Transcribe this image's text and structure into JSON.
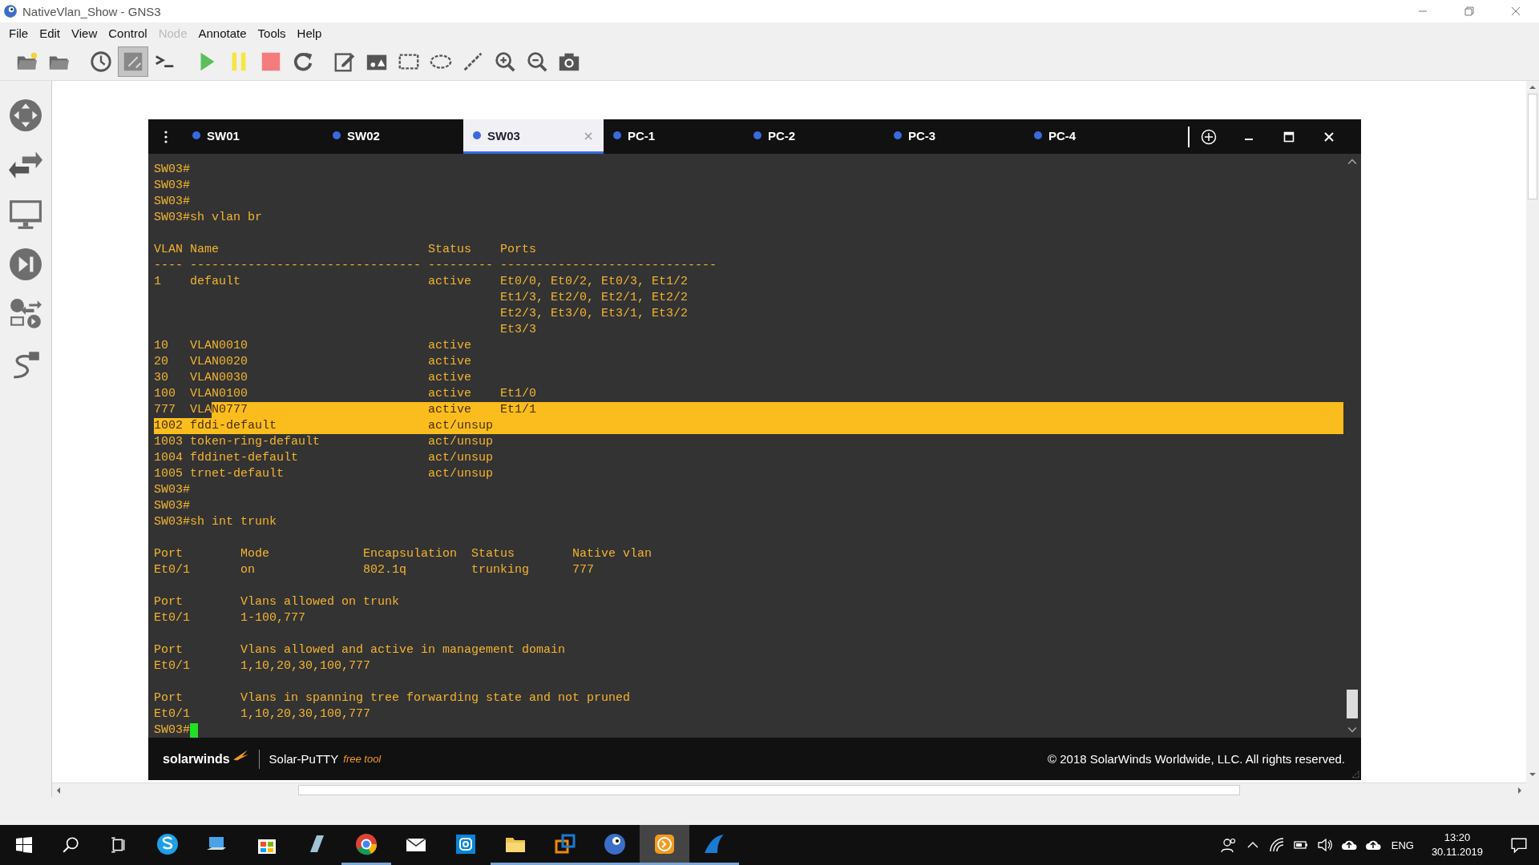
{
  "window": {
    "title": "NativeVlan_Show - GNS3"
  },
  "menu": [
    {
      "label": "File",
      "disabled": false
    },
    {
      "label": "Edit",
      "disabled": false
    },
    {
      "label": "View",
      "disabled": false
    },
    {
      "label": "Control",
      "disabled": false
    },
    {
      "label": "Node",
      "disabled": true
    },
    {
      "label": "Annotate",
      "disabled": false
    },
    {
      "label": "Tools",
      "disabled": false
    },
    {
      "label": "Help",
      "disabled": false
    }
  ],
  "toolbar": [
    {
      "kind": "new-project",
      "selected": false
    },
    {
      "kind": "open",
      "selected": false
    },
    {
      "kind": "snapshot",
      "selected": false
    },
    {
      "kind": "labels",
      "selected": true
    },
    {
      "kind": "console",
      "selected": false
    },
    {
      "kind": "start",
      "selected": false
    },
    {
      "kind": "suspend",
      "selected": false
    },
    {
      "kind": "stop",
      "selected": false
    },
    {
      "kind": "reload",
      "selected": false
    },
    {
      "kind": "note",
      "selected": false
    },
    {
      "kind": "image",
      "selected": false
    },
    {
      "kind": "rectangle",
      "selected": false
    },
    {
      "kind": "ellipse",
      "selected": false
    },
    {
      "kind": "line",
      "selected": false
    },
    {
      "kind": "zoom-in",
      "selected": false
    },
    {
      "kind": "zoom-out",
      "selected": false
    },
    {
      "kind": "screenshot",
      "selected": false
    }
  ],
  "terminal": {
    "tabs": [
      {
        "label": "SW01",
        "selected": false
      },
      {
        "label": "SW02",
        "selected": false
      },
      {
        "label": "SW03",
        "selected": true
      },
      {
        "label": "PC-1",
        "selected": false
      },
      {
        "label": "PC-2",
        "selected": false
      },
      {
        "label": "PC-3",
        "selected": false
      },
      {
        "label": "PC-4",
        "selected": false
      }
    ],
    "lines": [
      {
        "kind": "text",
        "text": "SW03#"
      },
      {
        "kind": "text",
        "text": "SW03#"
      },
      {
        "kind": "text",
        "text": "SW03#"
      },
      {
        "kind": "text",
        "text": "SW03#sh vlan br"
      },
      {
        "kind": "blank"
      },
      {
        "kind": "text",
        "text": "VLAN Name                             Status    Ports"
      },
      {
        "kind": "text",
        "text": "---- -------------------------------- --------- ------------------------------"
      },
      {
        "kind": "text",
        "text": "1    default                          active    Et0/0, Et0/2, Et0/3, Et1/2"
      },
      {
        "kind": "text",
        "text": "                                                Et1/3, Et2/0, Et2/1, Et2/2"
      },
      {
        "kind": "text",
        "text": "                                                Et2/3, Et3/0, Et3/1, Et3/2"
      },
      {
        "kind": "text",
        "text": "                                                Et3/3"
      },
      {
        "kind": "text",
        "text": "10   VLAN0010                         active"
      },
      {
        "kind": "text",
        "text": "20   VLAN0020                         active"
      },
      {
        "kind": "text",
        "text": "30   VLAN0030                         active"
      },
      {
        "kind": "text",
        "text": "100  VLAN0100                         active    Et1/0"
      },
      {
        "kind": "text",
        "text": "777  VLA",
        "selected_text": "N0777                         active    Et1/1"
      },
      {
        "kind": "text",
        "selected_text": "1002 fddi-default                     act/unsup"
      },
      {
        "kind": "text",
        "text": "1003 token-ring-default               act/unsup"
      },
      {
        "kind": "text",
        "text": "1004 fddinet-default                  act/unsup"
      },
      {
        "kind": "text",
        "text": "1005 trnet-default                    act/unsup"
      },
      {
        "kind": "text",
        "text": "SW03#"
      },
      {
        "kind": "text",
        "text": "SW03#"
      },
      {
        "kind": "text",
        "text": "SW03#sh int trunk"
      },
      {
        "kind": "blank"
      },
      {
        "kind": "text",
        "text": "Port        Mode             Encapsulation  Status        Native vlan"
      },
      {
        "kind": "text",
        "text": "Et0/1       on               802.1q         trunking      777"
      },
      {
        "kind": "blank"
      },
      {
        "kind": "text",
        "text": "Port        Vlans allowed on trunk"
      },
      {
        "kind": "text",
        "text": "Et0/1       1-100,777"
      },
      {
        "kind": "blank"
      },
      {
        "kind": "text",
        "text": "Port        Vlans allowed and active in management domain"
      },
      {
        "kind": "text",
        "text": "Et0/1       1,10,20,30,100,777"
      },
      {
        "kind": "blank"
      },
      {
        "kind": "text",
        "text": "Port        Vlans in spanning tree forwarding state and not pruned"
      },
      {
        "kind": "text",
        "text": "Et0/1       1,10,20,30,100,777"
      },
      {
        "kind": "cursor",
        "text": "SW03#"
      }
    ],
    "footer": {
      "brand": "solarwinds",
      "product": "Solar-PuTTY",
      "edition": "free tool",
      "copyright": "© 2018 SolarWinds Worldwide, LLC. All rights reserved."
    }
  },
  "taskbar": {
    "apps": [
      {
        "kind": "chat",
        "running": false,
        "selected": false
      },
      {
        "kind": "laptop",
        "running": false,
        "selected": false
      },
      {
        "kind": "store",
        "running": false,
        "selected": false
      },
      {
        "kind": "notepad",
        "running": false,
        "selected": false
      },
      {
        "kind": "browser",
        "running": true,
        "selected": false
      },
      {
        "kind": "mail",
        "running": false,
        "selected": false
      },
      {
        "kind": "camera",
        "running": false,
        "selected": false
      },
      {
        "kind": "folder",
        "running": true,
        "selected": false
      },
      {
        "kind": "boxes",
        "running": true,
        "selected": false
      },
      {
        "kind": "globe",
        "running": true,
        "selected": false
      },
      {
        "kind": "terminal",
        "running": true,
        "selected": true
      },
      {
        "kind": "fin",
        "running": true,
        "selected": false
      }
    ],
    "language": "ENG",
    "time": "13:20",
    "date": "30.11.2019"
  }
}
